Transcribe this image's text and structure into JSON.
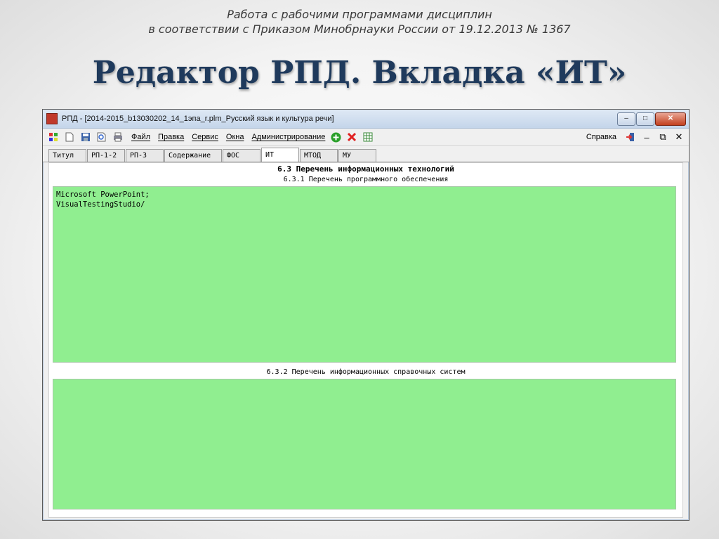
{
  "slide": {
    "caption_line1": "Работа с рабочими программами дисциплин",
    "caption_line2": "в соответствии с Приказом Минобрнауки России от 19.12.2013 № 1367",
    "title": "Редактор РПД. Вкладка «ИТ»"
  },
  "window": {
    "title": "РПД - [2014-2015_b13030202_14_1эпа_r.plm_Русский язык и культура речи]",
    "minimize_symbol": "–",
    "maximize_symbol": "□",
    "close_symbol": "✕"
  },
  "menubar": {
    "icons": [
      "grid-icon",
      "new-document-icon",
      "save-icon",
      "print-preview-icon",
      "print-icon"
    ],
    "items": [
      "Файл",
      "Правка",
      "Сервис",
      "Окна",
      "Администрирование"
    ],
    "action_icons": [
      "add-icon",
      "delete-icon",
      "table-icon"
    ],
    "help": "Справка",
    "right_controls": [
      "exit-icon",
      "–",
      "⧉",
      "✕"
    ]
  },
  "tabs": [
    "Титул",
    "РП-1-2",
    "РП-3",
    "Содержание",
    "ФОС",
    "ИТ",
    "МТОД",
    "МУ"
  ],
  "active_tab": "ИТ",
  "content": {
    "heading": "6.3 Перечень информационных технологий",
    "section1_title": "6.3.1 Перечень программного обеспечения",
    "section1_lines": [
      "Microsoft PowerPoint;",
      "VisualTestingStudio/"
    ],
    "section2_title": "6.3.2 Перечень информационных справочных систем",
    "section2_lines": []
  },
  "colors": {
    "green_fill": "#90ee90",
    "title_color": "#1f3a5c"
  }
}
